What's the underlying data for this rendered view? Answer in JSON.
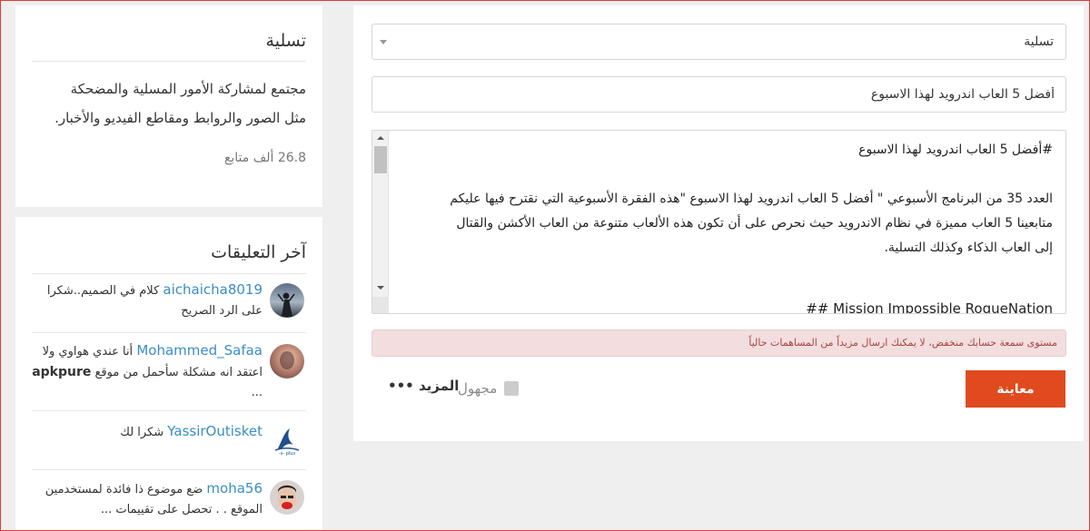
{
  "compose": {
    "category_value": "تسلية",
    "title_value": "أفضل 5 العاب اندرويد لهذا الاسبوع",
    "editor_lines": {
      "l1": "#أفضل 5 العاب اندرويد لهذا الاسبوع",
      "l2": "العدد 35 من البرنامج الأسبوعي \" أفضل 5 العاب اندرويد لهذا الاسبوع \"هذه الفقرة الأسبوعية التي نقترح فيها عليكم",
      "l3": "متابعينا 5 العاب مميزة في نظام الاندرويد حيث نحرص على أن تكون هذه الألعاب متنوعة من العاب الأكشن والقتال",
      "l4": "إلى العاب الذكاء وكذلك التسلية.",
      "l5": "## Mission Impossible RogueNation"
    },
    "warning": "مستوى سمعة حسابك منخفض، لا يمكنك ارسال مزيداً من المساهمات حالياً",
    "preview_label": "معاينة",
    "anonymous_label": "مجهول",
    "more_label": "المزيد •••"
  },
  "sidebar": {
    "about": {
      "title": "تسلية",
      "desc_line1": "مجتمع لمشاركة الأمور المسلية والمضحكة",
      "desc_line2": "مثل الصور والروابط ومقاطع الفيديو والأخبار.",
      "followers": "26.8 ألف متابع"
    },
    "comments": {
      "title": "آخر التعليقات",
      "items": [
        {
          "user": "aichaicha8019",
          "line1": "كلام في الصميم..شكرا",
          "line2": "على الرد الصريح",
          "avatar": "silhouette-photo"
        },
        {
          "user": "Mohammed_Safaa",
          "line1": "أنا عندي هواوي ولا",
          "line2a": "اعتقد انه مشكلة سأحمل من موقع",
          "line2b": "apkpure",
          "line3": "..."
        },
        {
          "user": "YassirOutisket",
          "line1": "شكرا لك"
        },
        {
          "user": "moha56",
          "line1": "ضع موضوع ذا فائدة لمستخدمين",
          "line2": "الموقع . . تحصل على تقييمات ..."
        }
      ]
    }
  }
}
